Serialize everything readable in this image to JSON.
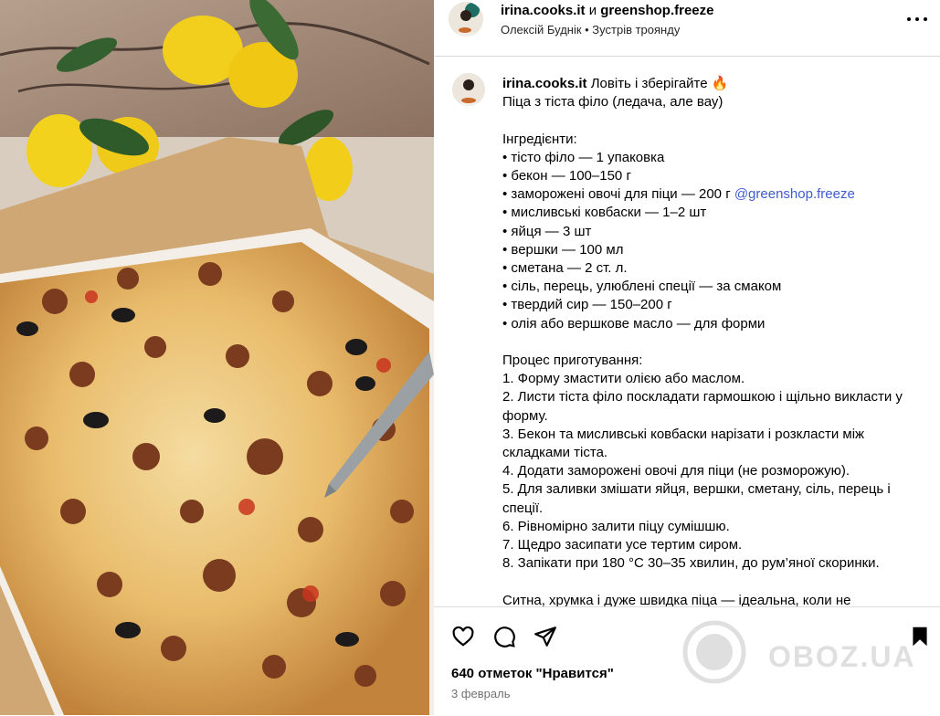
{
  "header": {
    "account1": "irina.cooks.it",
    "joiner": "и",
    "account2": "greenshop.freeze",
    "subtitle": "Олексій Буднік • Зустрів троянду"
  },
  "caption": {
    "username": "irina.cooks.it",
    "intro": "Ловіть і зберігайте 🔥",
    "dish": "Піца з тіста філо (ледача, але вау)",
    "ingredients_title": "Інгредієнти:",
    "ingredients": [
      "• тісто філо — 1 упаковка",
      "• бекон — 100–150 г",
      "• заморожені овочі для піци — 200 г ",
      "• мисливські ковбаски — 1–2 шт",
      "• яйця — 3 шт",
      "• вершки — 100 мл",
      "• сметана — 2 ст. л.",
      "• сіль, перець, улюблені спеції — за смаком",
      "• твердий сир — 150–200 г",
      "• олія або вершкове масло — для форми"
    ],
    "ingredient_mention": "@greenshop.freeze",
    "process_title": "Процес приготування:",
    "steps": [
      "1. Форму змастити олією або маслом.",
      "2. Листи тіста філо поскладати гармошкою і щільно викласти у форму.",
      "3. Бекон та мисливські ковбаски нарізати і розкласти між складками тіста.",
      "4. Додати заморожені овочі для піци (не розморожую).",
      "5. Для заливки змішати яйця, вершки, сметану, сіль, перець і спеції.",
      "6. Рівномірно залити піцу сумішшю.",
      "7. Щедро засипати усе тертим сиром.",
      "8. Запікати при 180 °C 30–35 хвилин, до рум’яної скоринки."
    ],
    "outro": "Ситна, хрумка і дуже швидка піца — ідеальна, коли не"
  },
  "actions": {
    "like_icon": "heart-icon",
    "comment_icon": "comment-icon",
    "share_icon": "share-icon",
    "save_icon": "bookmark-icon",
    "likes_text": "640 отметок \"Нравится\"",
    "date_text": "3 февраль"
  },
  "watermark": {
    "text": "OBOZ.UA"
  },
  "colors": {
    "mention": "#3f5bcf",
    "border": "#dbdbdb",
    "muted": "#737373"
  }
}
